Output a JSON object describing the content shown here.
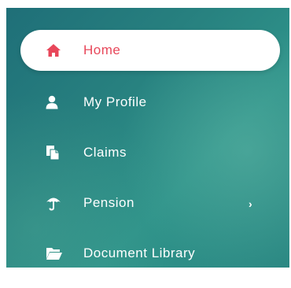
{
  "sidebar": {
    "items": [
      {
        "label": "Home",
        "icon": "home-icon",
        "active": true
      },
      {
        "label": "My Profile",
        "icon": "user-icon",
        "active": false
      },
      {
        "label": "Claims",
        "icon": "documents-icon",
        "active": false
      },
      {
        "label": "Pension",
        "icon": "umbrella-icon",
        "active": false,
        "has_submenu": true,
        "submenu_indicator": "›"
      },
      {
        "label": "Document Library",
        "icon": "folder-open-icon",
        "active": false
      }
    ]
  },
  "colors": {
    "active_text": "#e8475a",
    "sidebar_bg_start": "#1f6f78",
    "sidebar_bg_end": "#2f938a",
    "item_text": "#ffffff"
  }
}
